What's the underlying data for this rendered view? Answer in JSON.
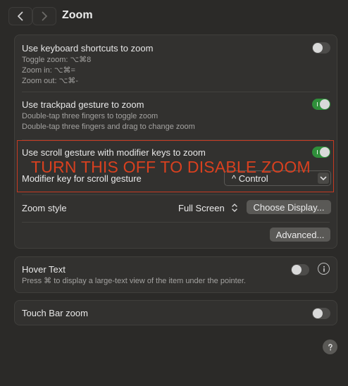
{
  "window": {
    "title": "Zoom"
  },
  "zoom_card": {
    "keyboard": {
      "label": "Use keyboard shortcuts to zoom",
      "lines": [
        "Toggle zoom: ⌥⌘8",
        "Zoom in: ⌥⌘=",
        "Zoom out: ⌥⌘-"
      ],
      "state": "off"
    },
    "trackpad": {
      "label": "Use trackpad gesture to zoom",
      "lines": [
        "Double-tap three fingers to toggle zoom",
        "Double-tap three fingers and drag to change zoom"
      ],
      "state": "on"
    },
    "scroll": {
      "label": "Use scroll gesture with modifier keys to zoom",
      "state": "on"
    },
    "modifier": {
      "label": "Modifier key for scroll gesture",
      "value": "^ Control"
    },
    "style": {
      "label": "Zoom style",
      "value": "Full Screen",
      "choose_display": "Choose Display..."
    },
    "advanced": "Advanced..."
  },
  "hover_card": {
    "label": "Hover Text",
    "description": "Press ⌘ to display a large-text view of the item under the pointer.",
    "state": "off"
  },
  "touchbar_card": {
    "label": "Touch Bar zoom",
    "state": "off"
  },
  "annotation": {
    "text": "TURN THIS OFF TO DISABLE ZOOM",
    "color": "#d9401f"
  },
  "colors": {
    "toggle_on": "#2f8f3a",
    "toggle_off": "#4d4c4a"
  },
  "icons": [
    "chevron-left-icon",
    "chevron-right-icon",
    "chevron-down-icon",
    "chevron-updown-icon",
    "info-icon",
    "help-icon"
  ]
}
